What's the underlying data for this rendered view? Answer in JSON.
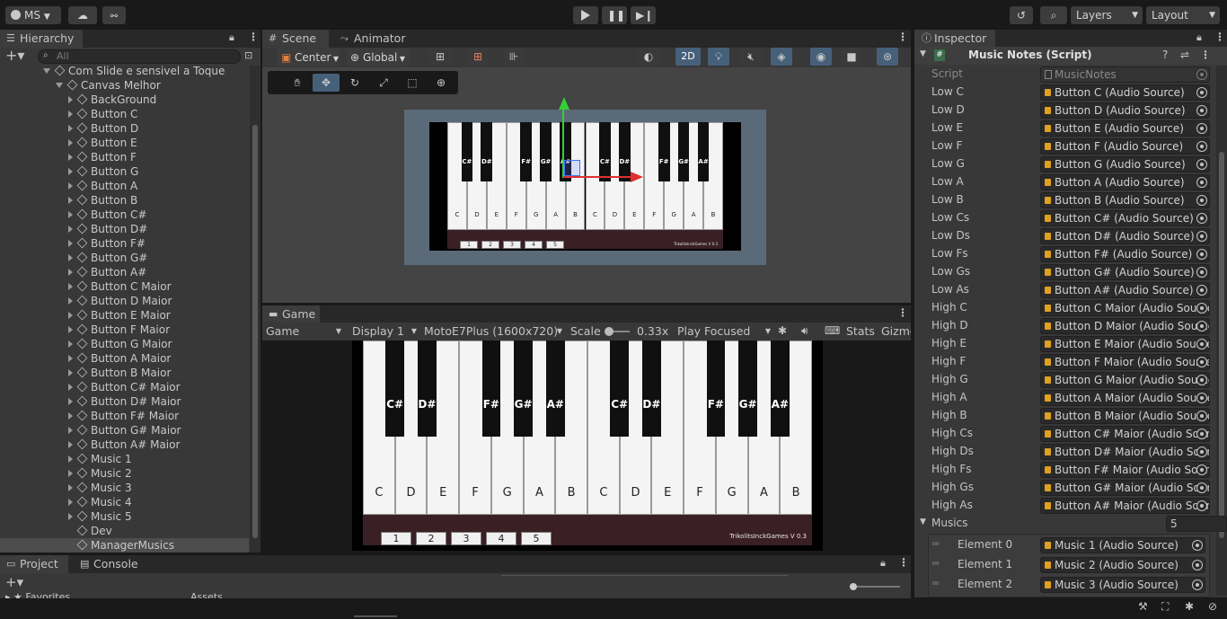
{
  "topbar": {
    "account": "MS",
    "layers": "Layers",
    "layout": "Layout"
  },
  "hierarchy": {
    "title": "Hierarchy",
    "search_placeholder": "All",
    "items": [
      {
        "label": "Com Slide e sensivel a Toque",
        "indent": 0,
        "expanded": true
      },
      {
        "label": "Canvas Melhor",
        "indent": 1,
        "expanded": true
      },
      {
        "label": "BackGround",
        "indent": 2,
        "expanded": false
      },
      {
        "label": "Button C",
        "indent": 2,
        "expanded": false
      },
      {
        "label": "Button D",
        "indent": 2,
        "expanded": false
      },
      {
        "label": "Button E",
        "indent": 2,
        "expanded": false
      },
      {
        "label": "Button F",
        "indent": 2,
        "expanded": false
      },
      {
        "label": "Button G",
        "indent": 2,
        "expanded": false
      },
      {
        "label": "Button A",
        "indent": 2,
        "expanded": false
      },
      {
        "label": "Button B",
        "indent": 2,
        "expanded": false
      },
      {
        "label": "Button C#",
        "indent": 2,
        "expanded": false
      },
      {
        "label": "Button D#",
        "indent": 2,
        "expanded": false
      },
      {
        "label": "Button F#",
        "indent": 2,
        "expanded": false
      },
      {
        "label": "Button G#",
        "indent": 2,
        "expanded": false
      },
      {
        "label": "Button A#",
        "indent": 2,
        "expanded": false
      },
      {
        "label": "Button C Maior",
        "indent": 2,
        "expanded": false
      },
      {
        "label": "Button D Maior",
        "indent": 2,
        "expanded": false
      },
      {
        "label": "Button E Maior",
        "indent": 2,
        "expanded": false
      },
      {
        "label": "Button F Maior",
        "indent": 2,
        "expanded": false
      },
      {
        "label": "Button G Maior",
        "indent": 2,
        "expanded": false
      },
      {
        "label": "Button A Maior",
        "indent": 2,
        "expanded": false
      },
      {
        "label": "Button B Maior",
        "indent": 2,
        "expanded": false
      },
      {
        "label": "Button C# Maior",
        "indent": 2,
        "expanded": false
      },
      {
        "label": "Button D# Maior",
        "indent": 2,
        "expanded": false
      },
      {
        "label": "Button F# Maior",
        "indent": 2,
        "expanded": false
      },
      {
        "label": "Button G# Maior",
        "indent": 2,
        "expanded": false
      },
      {
        "label": "Button A# Maior",
        "indent": 2,
        "expanded": false
      },
      {
        "label": "Music 1",
        "indent": 2,
        "expanded": false
      },
      {
        "label": "Music 2",
        "indent": 2,
        "expanded": false
      },
      {
        "label": "Music 3",
        "indent": 2,
        "expanded": false
      },
      {
        "label": "Music 4",
        "indent": 2,
        "expanded": false
      },
      {
        "label": "Music 5",
        "indent": 2,
        "expanded": false
      },
      {
        "label": "Dev",
        "indent": 2,
        "leaf": true
      },
      {
        "label": "ManagerMusics",
        "indent": 2,
        "leaf": true,
        "selected": true
      }
    ]
  },
  "bottom_tabs": {
    "project": "Project",
    "console": "Console",
    "favorites": "Favorites",
    "assets": "Assets"
  },
  "scene": {
    "tab_scene": "Scene",
    "tab_animator": "Animator",
    "pivot": "Center",
    "space": "Global",
    "mode_2d": "2D"
  },
  "game": {
    "tab": "Game",
    "mode": "Game",
    "display": "Display 1",
    "resolution": "MotoE7Plus (1600x720)",
    "scale_label": "Scale",
    "scale_value": "0.33x",
    "play_focused": "Play Focused",
    "stats": "Stats",
    "gizmos": "Gizmos"
  },
  "piano": {
    "white_keys": [
      "C",
      "D",
      "E",
      "F",
      "G",
      "A",
      "B",
      "C",
      "D",
      "E",
      "F",
      "G",
      "A",
      "B"
    ],
    "black_keys": [
      {
        "label": "C#",
        "after": 0
      },
      {
        "label": "D#",
        "after": 1
      },
      {
        "label": "F#",
        "after": 3
      },
      {
        "label": "G#",
        "after": 4
      },
      {
        "label": "A#",
        "after": 5
      },
      {
        "label": "C#",
        "after": 7
      },
      {
        "label": "D#",
        "after": 8
      },
      {
        "label": "F#",
        "after": 10
      },
      {
        "label": "G#",
        "after": 11
      },
      {
        "label": "A#",
        "after": 12
      }
    ],
    "music_buttons": [
      "1",
      "2",
      "3",
      "4",
      "5"
    ],
    "credit": "TrikolitsInckGames V 0.3"
  },
  "inspector": {
    "title": "Inspector",
    "component": "Music Notes (Script)",
    "script_label": "Script",
    "script_value": "MusicNotes",
    "fields": [
      {
        "label": "Low C",
        "value": "Button C (Audio Source)"
      },
      {
        "label": "Low D",
        "value": "Button D (Audio Source)"
      },
      {
        "label": "Low E",
        "value": "Button E (Audio Source)"
      },
      {
        "label": "Low F",
        "value": "Button F (Audio Source)"
      },
      {
        "label": "Low G",
        "value": "Button G (Audio Source)"
      },
      {
        "label": "Low A",
        "value": "Button A (Audio Source)"
      },
      {
        "label": "Low B",
        "value": "Button B (Audio Source)"
      },
      {
        "label": "Low Cs",
        "value": "Button C# (Audio Source)"
      },
      {
        "label": "Low Ds",
        "value": "Button D# (Audio Source)"
      },
      {
        "label": "Low Fs",
        "value": "Button F# (Audio Source)"
      },
      {
        "label": "Low Gs",
        "value": "Button G# (Audio Source)"
      },
      {
        "label": "Low As",
        "value": "Button A# (Audio Source)"
      },
      {
        "label": "High C",
        "value": "Button C Maior (Audio Source)"
      },
      {
        "label": "High D",
        "value": "Button D Maior (Audio Source)"
      },
      {
        "label": "High E",
        "value": "Button E Maior (Audio Source)"
      },
      {
        "label": "High F",
        "value": "Button F Maior (Audio Source)"
      },
      {
        "label": "High G",
        "value": "Button G Maior (Audio Source)"
      },
      {
        "label": "High A",
        "value": "Button A Maior (Audio Source)"
      },
      {
        "label": "High B",
        "value": "Button B Maior (Audio Source)"
      },
      {
        "label": "High Cs",
        "value": "Button C# Maior (Audio Source)"
      },
      {
        "label": "High Ds",
        "value": "Button D# Maior (Audio Source)"
      },
      {
        "label": "High Fs",
        "value": "Button F# Maior (Audio Source)"
      },
      {
        "label": "High Gs",
        "value": "Button G# Maior (Audio Source)"
      },
      {
        "label": "High As",
        "value": "Button A# Maior (Audio Source)"
      }
    ],
    "musics_label": "Musics",
    "musics_count": "5",
    "elements": [
      {
        "label": "Element 0",
        "value": "Music 1 (Audio Source)"
      },
      {
        "label": "Element 1",
        "value": "Music 2 (Audio Source)"
      },
      {
        "label": "Element 2",
        "value": "Music 3 (Audio Source)"
      }
    ]
  }
}
